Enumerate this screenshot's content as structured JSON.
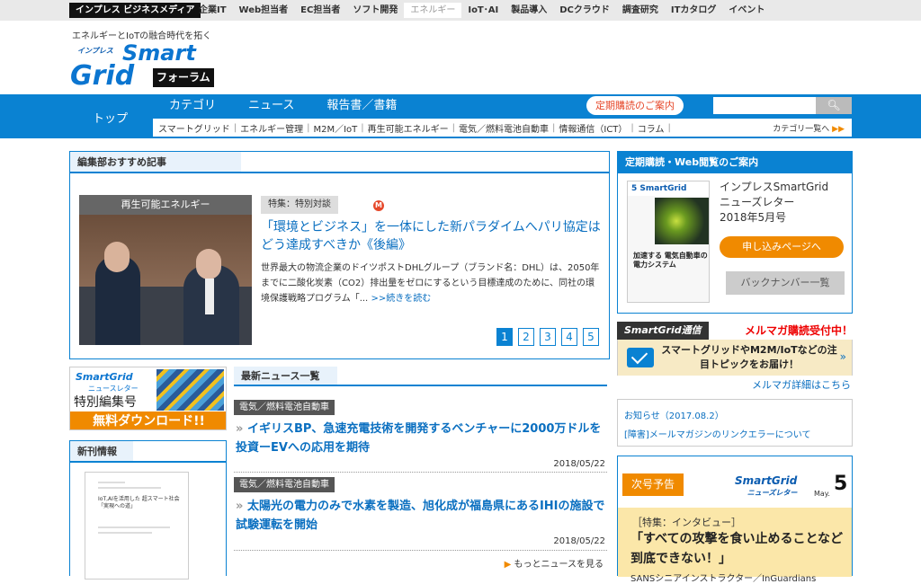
{
  "topbar": {
    "brand": "インプレス ビジネスメディア",
    "items": [
      "企業IT",
      "Web担当者",
      "EC担当者",
      "ソフト開発",
      "エネルギー",
      "IoT･AI",
      "製品導入",
      "DCクラウド",
      "調査研究",
      "ITカタログ",
      "イベント"
    ],
    "active_index": 4
  },
  "header": {
    "tagline": "エネルギーとIoTの融合時代を拓く",
    "logo_small": "インプレス",
    "logo_smart": "Smart",
    "logo_grid": "Grid",
    "logo_forum": "フォーラム"
  },
  "nav": {
    "home": "トップ",
    "tabs": [
      "カテゴリ",
      "ニュース",
      "報告書／書籍"
    ],
    "subscribe_button": "定期購読のご案内",
    "search_placeholder": "",
    "search_icon": "search-icon",
    "subcategories": [
      "スマートグリッド",
      "エネルギー管理",
      "M2M／IoT",
      "再生可能エネルギー",
      "電気／燃料電池自動車",
      "情報通信（ICT）",
      "コラム"
    ],
    "category_list": "カテゴリ一覧へ"
  },
  "recommended": {
    "heading": "編集部おすすめ記事",
    "image_caption": "再生可能エネルギー",
    "tag": "特集：特別対談",
    "mark": "M",
    "title": "「環境とビジネス」を一体にした新パラダイムへパリ協定はどう達成すべきか《後編》",
    "body": "世界最大の物流企業のドイツポストDHLグループ（ブランド名：DHL）は、2050年までに二酸化炭素（CO2）排出量をゼロにするという目標達成のために、同社の環境保護戦略プログラム「...",
    "more": ">>続きを読む",
    "pages": [
      "1",
      "2",
      "3",
      "4",
      "5"
    ],
    "current_page": "1"
  },
  "left_banner": {
    "logo": "SmartGrid",
    "sub": "ニュースレター",
    "title": "特別編集号",
    "cta": "無料ダウンロード!!"
  },
  "new_publications": {
    "heading": "新刊情報",
    "cover_text": "IoT,AIを活用した 超スマート社会「実現への道」"
  },
  "news": {
    "heading": "最新ニュース一覧",
    "items": [
      {
        "category": "電気／燃料電池自動車",
        "title": "イギリスBP、急速充電技術を開発するベンチャーに2000万ドルを投資ーEVへの応用を期待",
        "date": "2018/05/22"
      },
      {
        "category": "電気／燃料電池自動車",
        "title": "太陽光の電力のみで水素を製造、旭化成が福島県にあるIHIの施設で試験運転を開始",
        "date": "2018/05/22"
      }
    ],
    "more": "もっとニュースを見る"
  },
  "subscription": {
    "heading": "定期購読・Web閲覧のご案内",
    "magazine_header": "5 SmartGrid",
    "magazine_cover_text": "加速する 電気自動車の 電力システム",
    "title_lines": [
      "インプレスSmartGrid",
      "ニューズレター",
      "2018年5月号"
    ],
    "apply_button": "申し込みページへ",
    "backnumber_button": "バックナンバー一覧"
  },
  "mailmag": {
    "label": "SmartGrid通信",
    "headline": "メルマガ購読受付中！",
    "message": "スマートグリッドやM2M/IoTなどの注目トピックをお届け！",
    "details_link": "メルマガ詳細はこちら"
  },
  "notice": {
    "date": "お知らせ（2017.08.2）",
    "link": "[障害]メールマガジンのリンクエラーについて"
  },
  "next_issue": {
    "badge": "次号予告",
    "logo": "SmartGrid",
    "logo_sub": "ニューズレター",
    "month": "May.",
    "number": "5",
    "special": "［特集：インタビュー］",
    "title": "「すべての攻撃を食い止めることなど到底できない！」",
    "author": "SANSシニアインストラクター／InGuardians"
  }
}
